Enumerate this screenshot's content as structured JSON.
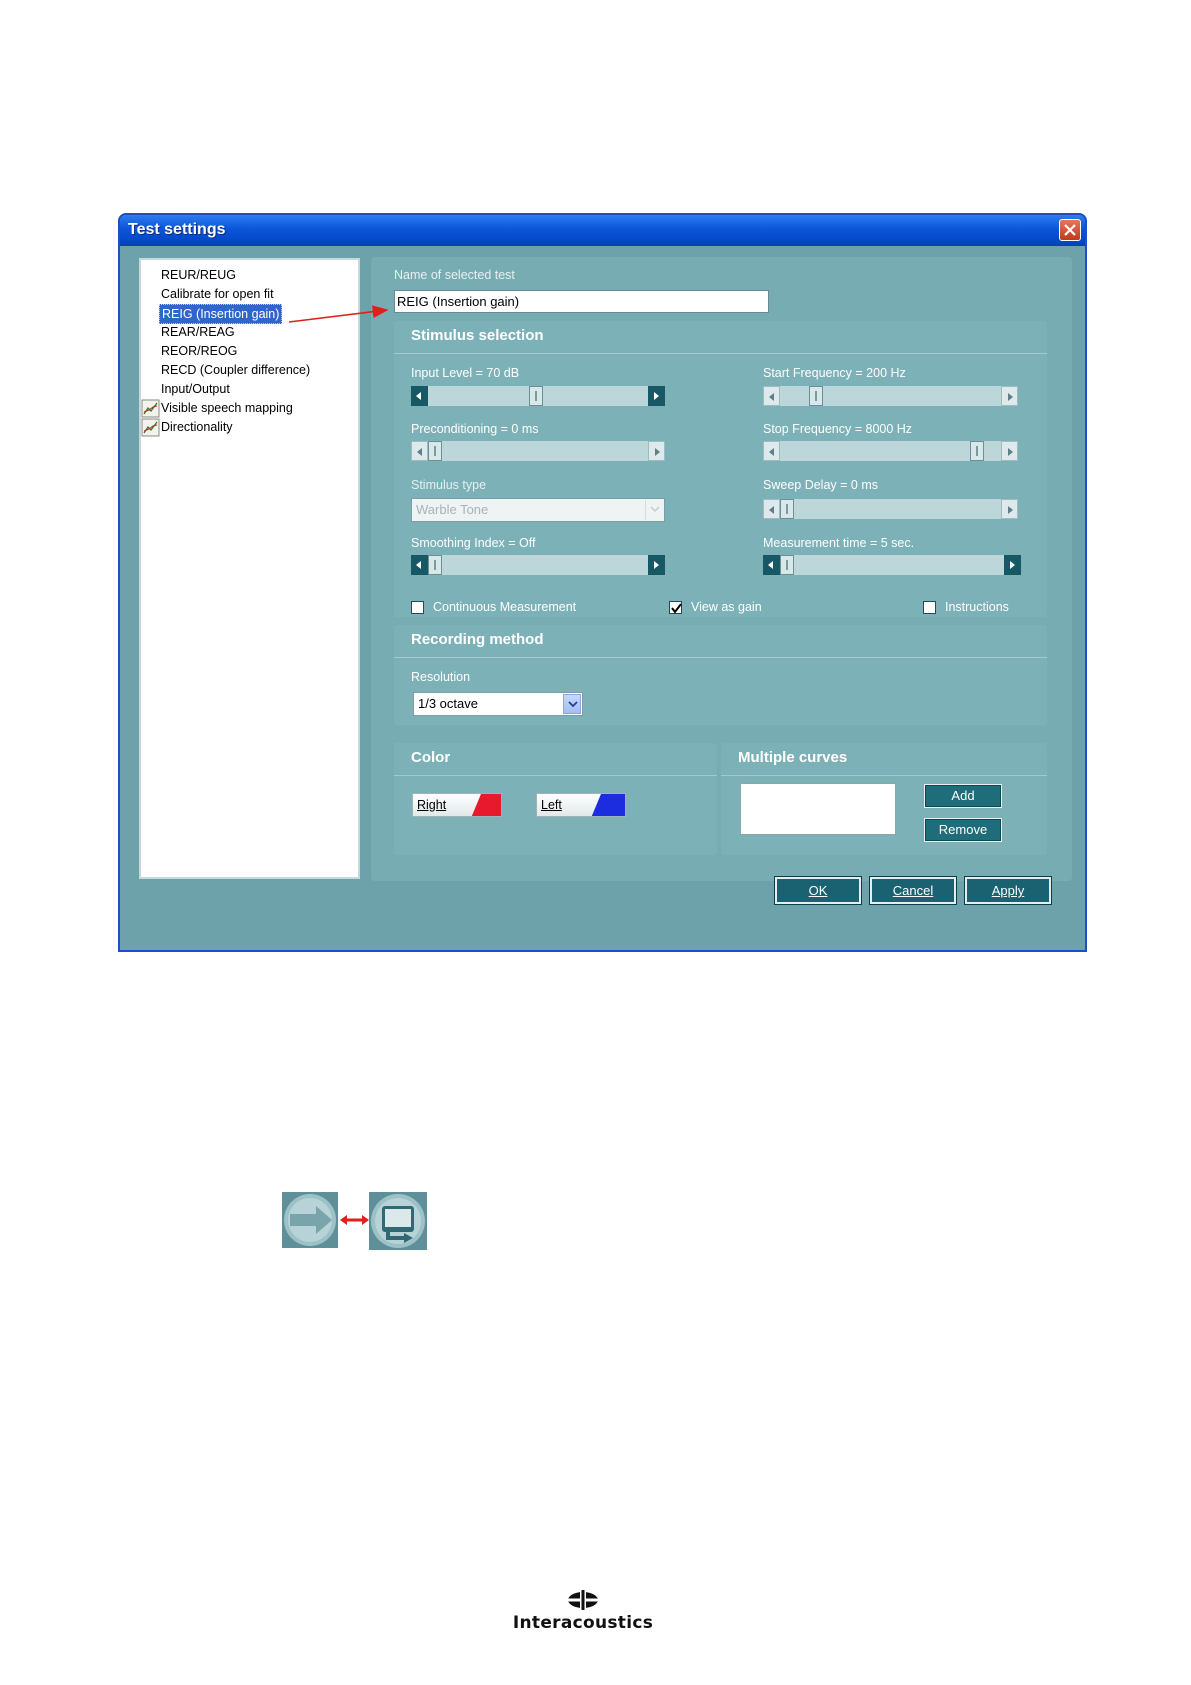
{
  "dialog": {
    "title": "Test settings"
  },
  "test_list": {
    "items": [
      {
        "label": "REUR/REUG",
        "selected": false,
        "icon": null
      },
      {
        "label": "Calibrate for open fit",
        "selected": false,
        "icon": null
      },
      {
        "label": "REIG (Insertion gain)",
        "selected": true,
        "icon": null
      },
      {
        "label": "REAR/REAG",
        "selected": false,
        "icon": null
      },
      {
        "label": "REOR/REOG",
        "selected": false,
        "icon": null
      },
      {
        "label": "RECD (Coupler difference)",
        "selected": false,
        "icon": null
      },
      {
        "label": "Input/Output",
        "selected": false,
        "icon": null
      },
      {
        "label": "Visible speech mapping",
        "selected": false,
        "icon": "graph-icon"
      },
      {
        "label": "Directionality",
        "selected": false,
        "icon": "graph-icon"
      }
    ]
  },
  "name_section": {
    "label": "Name of selected test",
    "value": "REIG (Insertion gain)"
  },
  "stimulus": {
    "title": "Stimulus selection",
    "input_level": {
      "label": "Input Level = 70 dB",
      "value_db": 70
    },
    "preconditioning": {
      "label": "Preconditioning = 0 ms",
      "value_ms": 0
    },
    "stimulus_type": {
      "label": "Stimulus type",
      "value": "Warble Tone",
      "enabled": false
    },
    "smoothing": {
      "label": "Smoothing Index = Off"
    },
    "start_freq": {
      "label": "Start Frequency = 200 Hz",
      "value_hz": 200
    },
    "stop_freq": {
      "label": "Stop Frequency = 8000 Hz",
      "value_hz": 8000
    },
    "sweep_delay": {
      "label": "Sweep Delay = 0 ms",
      "value_ms": 0
    },
    "meas_time": {
      "label": "Measurement time = 5 sec.",
      "value_s": 5
    },
    "continuous": {
      "label": "Continuous Measurement",
      "checked": false
    },
    "view_gain": {
      "label": "View as gain",
      "checked": true
    },
    "instructions": {
      "label": "Instructions",
      "checked": false
    }
  },
  "recording": {
    "title": "Recording method",
    "resolution_label": "Resolution",
    "resolution_value": "1/3 octave"
  },
  "color": {
    "title": "Color",
    "right_label": "Right",
    "left_label": "Left",
    "right_color": "#e8192c",
    "left_color": "#1c2de0"
  },
  "multiple_curves": {
    "title": "Multiple curves",
    "add_label": "Add",
    "remove_label": "Remove"
  },
  "footer": {
    "ok_label": "OK",
    "cancel_label": "Cancel",
    "apply_label": "Apply"
  },
  "nav_icons": {
    "left_icon": "arrow-right-icon",
    "right_icon": "screen-return-icon",
    "connector": "double-arrow-icon"
  },
  "logo": {
    "brand": "Interacoustics"
  },
  "colors": {
    "titlebar": "#0a56d8",
    "dialog_bg": "#6ea2aa",
    "selection": "#2f66c9",
    "button": "#1a6272",
    "annotation": "#e0201c"
  }
}
